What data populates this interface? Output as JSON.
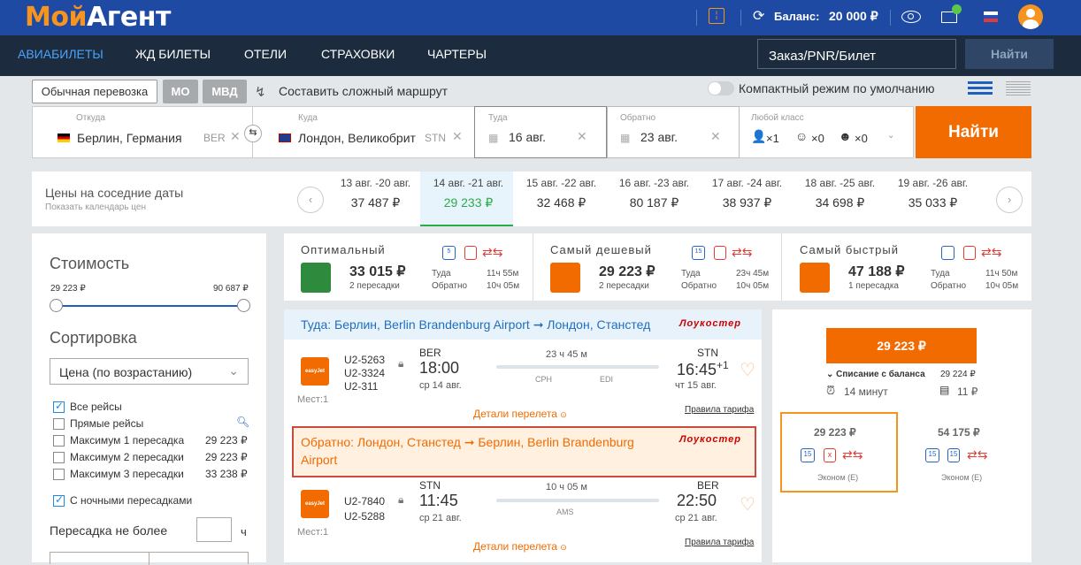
{
  "header": {
    "logo_part1": "Мой",
    "logo_part2": "Агент",
    "balance_label": "Баланс:",
    "balance_value": "20 000 ₽"
  },
  "nav": {
    "items": [
      "АВИАБИЛЕТЫ",
      "ЖД БИЛЕТЫ",
      "ОТЕЛИ",
      "СТРАХОВКИ",
      "ЧАРТЕРЫ"
    ],
    "order_placeholder": "Заказ/PNR/Билет",
    "find": "Найти"
  },
  "options": {
    "normal": "Обычная перевозка",
    "mo": "МО",
    "mvd": "МВД",
    "complex": "Составить сложный маршрут",
    "compact": "Компактный режим по умолчанию"
  },
  "search": {
    "from_label": "Откуда",
    "from_value": "Берлин, Германия",
    "from_code": "BER",
    "to_label": "Куда",
    "to_value": "Лондон, Великобрит",
    "to_code": "STN",
    "dep_label": "Туда",
    "dep_value": "16 авг.",
    "ret_label": "Обратно",
    "ret_value": "23 авг.",
    "class_label": "Любой класс",
    "adults": "×1",
    "children": "×0",
    "infants": "×0",
    "find": "Найти"
  },
  "dates": {
    "title": "Цены на соседние даты",
    "subtitle": "Показать календарь цен",
    "items": [
      {
        "d": "13 авг. -20 авг.",
        "p": "37 487 ₽"
      },
      {
        "d": "14 авг. -21 авг.",
        "p": "29 233 ₽"
      },
      {
        "d": "15 авг. -22 авг.",
        "p": "32 468 ₽"
      },
      {
        "d": "16 авг. -23 авг.",
        "p": "80 187 ₽"
      },
      {
        "d": "17 авг. -24 авг.",
        "p": "38 937 ₽"
      },
      {
        "d": "18 авг. -25 авг.",
        "p": "34 698 ₽"
      },
      {
        "d": "19 авг. -26 авг.",
        "p": "35 033 ₽"
      }
    ]
  },
  "filters": {
    "cost": "Стоимость",
    "min": "29 223 ₽",
    "max": "90 687 ₽",
    "sort": "Сортировка",
    "sort_value": "Цена (по возрастанию)",
    "all": "Все рейсы",
    "direct": "Прямые рейсы",
    "max1": "Максимум 1 пересадка",
    "max1_price": "29 223 ₽",
    "max2": "Максимум 2 пересадки",
    "max2_price": "29 223 ₽",
    "max3": "Максимум 3 пересадки",
    "max3_price": "33 238 ₽",
    "night": "С ночными пересадками",
    "transfer": "Пересадка не более",
    "hours": "ч"
  },
  "summary": [
    {
      "title": "Оптимальный",
      "price": "33 015 ₽",
      "stops": "2 пересадки",
      "lug": "5",
      "l1": "Туда",
      "t1": "11ч 55м",
      "l2": "Обратно",
      "t2": "10ч 05м"
    },
    {
      "title": "Самый дешевый",
      "price": "29 223 ₽",
      "stops": "2 пересадки",
      "lug": "15",
      "l1": "Туда",
      "t1": "23ч 45м",
      "l2": "Обратно",
      "t2": "10ч 05м"
    },
    {
      "title": "Самый быстрый",
      "price": "47 188 ₽",
      "stops": "1 пересадка",
      "lug": "",
      "l1": "Туда",
      "t1": "11ч 50м",
      "l2": "Обратно",
      "t2": "10ч 05м"
    }
  ],
  "outbound": {
    "header": "Туда: Берлин, Berlin Brandenburg Airport ➞ Лондон, Станстед",
    "lowcost": "Лоукостер",
    "flights": [
      "U2-5263",
      "U2-3324",
      "U2-311"
    ],
    "dep_code": "BER",
    "dep_time": "18:00",
    "dep_date": "ср 14 авг.",
    "duration": "23 ч 45 м",
    "stop1": "CPH",
    "stop2": "EDI",
    "arr_code": "STN",
    "arr_time": "16:45",
    "arr_plus": "+1",
    "arr_date": "чт 15 авг.",
    "seats": "Мест:1",
    "details": "Детали перелета",
    "rules": "Правила тарифа",
    "airline": "easyJet"
  },
  "inbound": {
    "header": "Обратно: Лондон, Станстед ➞ Берлин, Berlin Brandenburg Airport",
    "lowcost": "Лоукостер",
    "flights": [
      "U2-7840",
      "U2-5288"
    ],
    "dep_code": "STN",
    "dep_time": "11:45",
    "dep_date": "ср 21 авг.",
    "duration": "10 ч 05 м",
    "stop1": "AMS",
    "arr_code": "BER",
    "arr_time": "22:50",
    "arr_date": "ср 21 авг.",
    "seats": "Мест:1",
    "details": "Детали перелета",
    "rules": "Правила тарифа",
    "airline": "easyJet"
  },
  "price_panel": {
    "main": "29 223 ₽",
    "deduct_label": "Списание с баланса",
    "deduct_value": "29 224 ₽",
    "time": "14 минут",
    "fee": "11 ₽",
    "fare1_price": "29 223 ₽",
    "fare1_class": "Эконом (E)",
    "fare1_lug": "15",
    "fare2_price": "54 175 ₽",
    "fare2_class": "Эконом (E)",
    "fare2_lug": "15"
  },
  "colors": {
    "brand_blue": "#1e4aa3",
    "accent_orange": "#f26b00",
    "nav_dark": "#1c2b3d",
    "selected_green": "#2eaa4a"
  }
}
